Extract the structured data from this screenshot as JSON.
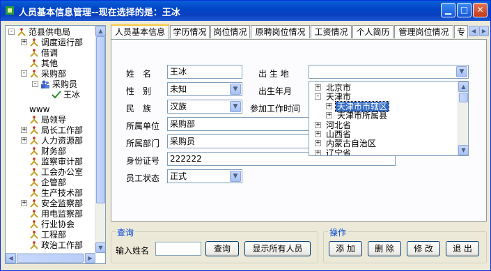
{
  "window": {
    "title": "人员基本信息管理--现在选择的是：王冰"
  },
  "tree": {
    "items": [
      {
        "label": "范县供电局",
        "pm": "-"
      },
      {
        "label": "调度运行部",
        "pm": "+"
      },
      {
        "label": "借调",
        "pm": ""
      },
      {
        "label": "其他",
        "pm": ""
      },
      {
        "label": "采购部",
        "pm": "-"
      },
      {
        "label": "采购员",
        "pm": "-"
      },
      {
        "label": "王冰",
        "pm": ""
      },
      {
        "label": "www",
        "pm": ""
      },
      {
        "label": "局领导",
        "pm": ""
      },
      {
        "label": "局长工作部",
        "pm": "+"
      },
      {
        "label": "人力资源部",
        "pm": "+"
      },
      {
        "label": "财务部",
        "pm": ""
      },
      {
        "label": "监察审计部",
        "pm": ""
      },
      {
        "label": "工会办公室",
        "pm": ""
      },
      {
        "label": "企管部",
        "pm": ""
      },
      {
        "label": "生产技术部",
        "pm": ""
      },
      {
        "label": "安全监察部",
        "pm": "+"
      },
      {
        "label": "用电监察部",
        "pm": ""
      },
      {
        "label": "行业协会",
        "pm": ""
      },
      {
        "label": "工程部",
        "pm": ""
      },
      {
        "label": "政治工作部",
        "pm": ""
      }
    ]
  },
  "tabs": [
    "人员基本信息",
    "学历情况",
    "岗位情况",
    "原聘岗位情况",
    "工资情况",
    "个人简历",
    "管理岗位情况",
    "专"
  ],
  "form": {
    "name_label": "姓　名",
    "name_value": "王冰",
    "gender_label": "性　别",
    "gender_value": "未知",
    "ethnic_label": "民　族",
    "ethnic_value": "汉族",
    "unit_label": "所属单位",
    "unit_value": "采购部",
    "dept_label": "所属部门",
    "dept_value": "采购员",
    "id_label": "身份证号",
    "id_value": "222222",
    "status_label": "员工状态",
    "status_value": "正式",
    "birthplace_label": "出 生 地",
    "birthplace_value": "",
    "birthdate_label": "出生年月",
    "workstart_label": "参加工作时间"
  },
  "dropdown": {
    "items": [
      {
        "label": "北京市",
        "pm": "+",
        "level": 0
      },
      {
        "label": "天津市",
        "pm": "-",
        "level": 0
      },
      {
        "label": "天津市市辖区",
        "pm": "+",
        "level": 1,
        "selected": true
      },
      {
        "label": "天津市所属县",
        "pm": "+",
        "level": 1
      },
      {
        "label": "河北省",
        "pm": "+",
        "level": 0
      },
      {
        "label": "山西省",
        "pm": "+",
        "level": 0
      },
      {
        "label": "内蒙古自治区",
        "pm": "+",
        "level": 0
      },
      {
        "label": "辽宁省",
        "pm": "+",
        "level": 0
      }
    ]
  },
  "query": {
    "title": "查询",
    "name_label": "输入姓名",
    "name_value": "",
    "query_btn": "查询",
    "showall_btn": "显示所有人员"
  },
  "ops": {
    "title": "操作",
    "add": "添 加",
    "delete": "删 除",
    "edit": "修 改",
    "exit": "退 出"
  },
  "colors": {
    "titlebar": "#0a54d6",
    "selection": "#316ac5",
    "accent_tab": "#ffc83c"
  }
}
